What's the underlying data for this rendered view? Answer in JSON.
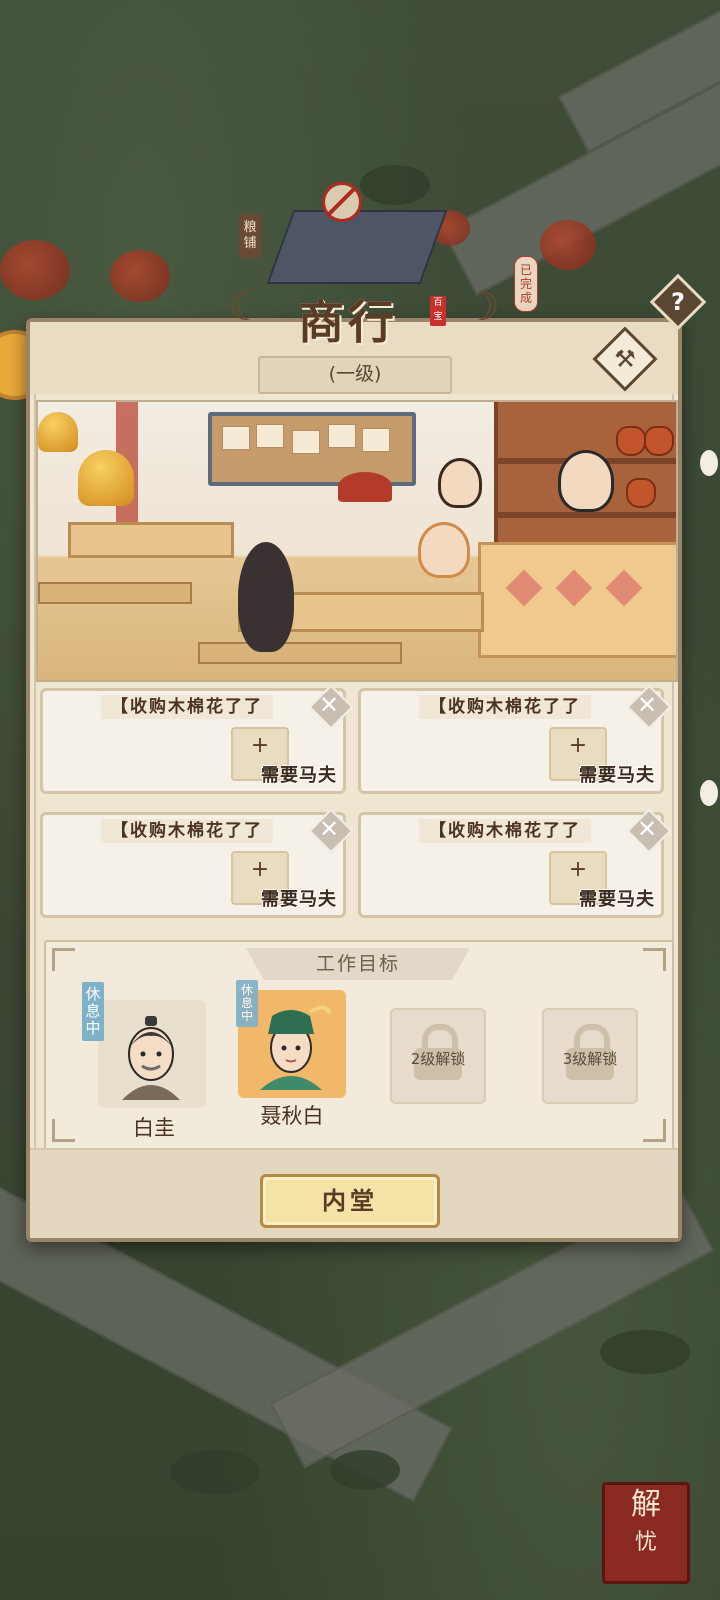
{
  "map": {
    "shop_sign": "粮铺",
    "done_tag": "已完成"
  },
  "panel": {
    "title": "商行",
    "title_seal": "百宝",
    "help_symbol": "?",
    "level": "(一级)",
    "tasks": [
      {
        "title": "【收购木棉花了了",
        "need": "需要马夫"
      },
      {
        "title": "【收购木棉花了了",
        "need": "需要马夫"
      },
      {
        "title": "【收购木棉花了了",
        "need": "需要马夫"
      },
      {
        "title": "【收购木棉花了了",
        "need": "需要马夫"
      }
    ],
    "work_target": {
      "header": "工作目标",
      "characters": [
        {
          "name": "白圭",
          "status": "休息中"
        },
        {
          "name": "聂秋白",
          "status": "休息中"
        }
      ],
      "locked_slots": [
        "2级解锁",
        "3级解锁"
      ]
    },
    "inner_hall_button": "内堂"
  },
  "solve_button": [
    "解",
    "忧"
  ],
  "colors": {
    "panel_bg": "#efe6d2",
    "title_brown": "#5a3b23",
    "status_blue": "#7fb1c9",
    "button_gold": "#f5e2a6",
    "solve_red": "#8b2a22"
  }
}
